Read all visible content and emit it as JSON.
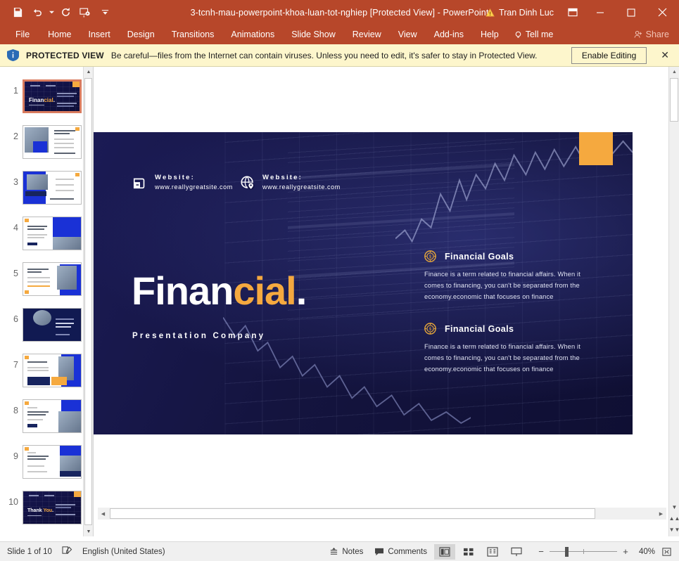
{
  "titlebar": {
    "document_title": "3-tcnh-mau-powerpoint-khoa-luan-tot-nghiep [Protected View]  -  PowerPoint",
    "account_name": "Tran Dinh Luc",
    "qat": [
      {
        "name": "save-icon",
        "label": "Save"
      },
      {
        "name": "undo-icon",
        "label": "Undo"
      },
      {
        "name": "redo-icon",
        "label": "Redo"
      },
      {
        "name": "start-presentation-icon",
        "label": "Start From Beginning"
      },
      {
        "name": "customize-quick-access-toolbar-icon",
        "label": "Customize Quick Access Toolbar"
      }
    ],
    "window_controls": {
      "ribbon_display_options": "Ribbon Display Options",
      "minimize": "Minimize",
      "maximize": "Restore Down",
      "close": "Close"
    }
  },
  "ribbon": {
    "tabs": [
      "File",
      "Home",
      "Insert",
      "Design",
      "Transitions",
      "Animations",
      "Slide Show",
      "Review",
      "View",
      "Add-ins",
      "Help"
    ],
    "tell_me": "Tell me",
    "share": "Share"
  },
  "protected_view": {
    "label": "PROTECTED VIEW",
    "message": "Be careful—files from the Internet can contain viruses. Unless you need to edit, it's safer to stay in Protected View.",
    "enable_button": "Enable Editing",
    "close": "✕"
  },
  "thumbnails": [
    {
      "number": "1",
      "style": "dark-title",
      "selected": true
    },
    {
      "number": "2",
      "style": "white-photo-left",
      "selected": false
    },
    {
      "number": "3",
      "style": "white-blue-left",
      "selected": false
    },
    {
      "number": "4",
      "style": "white-blue-right",
      "selected": false
    },
    {
      "number": "5",
      "style": "white-photo-right",
      "selected": false
    },
    {
      "number": "6",
      "style": "navy-photo",
      "selected": false
    },
    {
      "number": "7",
      "style": "white-photo-blue",
      "selected": false
    },
    {
      "number": "8",
      "style": "white-photo-corner",
      "selected": false
    },
    {
      "number": "9",
      "style": "white-photo-navy",
      "selected": false
    },
    {
      "number": "10",
      "style": "dark-thanks",
      "selected": false
    }
  ],
  "slide": {
    "title_part1": "Finan",
    "title_part2": "cial",
    "title_part3": ".",
    "subtitle": "Presentation Company",
    "contacts": [
      {
        "icon": "wallet-icon",
        "label": "Website:",
        "url": "www.reallygreatsite.com"
      },
      {
        "icon": "globe-pin-icon",
        "label": "Website:",
        "url": "www.reallygreatsite.com"
      }
    ],
    "goals": [
      {
        "icon": "coin-icon",
        "title": "Financial Goals",
        "body": "Finance is a term related to financial affairs. When it comes to financing, you can't be separated from the economy.economic that focuses on finance"
      },
      {
        "icon": "coin-icon",
        "title": "Financial Goals",
        "body": "Finance is a term related to financial affairs. When it comes to financing, you can't be separated from the economy.economic that focuses on finance"
      }
    ],
    "colors": {
      "background": "#141445",
      "accent_orange": "#f5a93f",
      "title_white": "#ffffff"
    }
  },
  "statusbar": {
    "slide_counter": "Slide 1 of 10",
    "spellcheck_icon": "proofing-icon",
    "language": "English (United States)",
    "notes": "Notes",
    "comments": "Comments",
    "views": [
      {
        "name": "normal-view-button",
        "active": true
      },
      {
        "name": "slide-sorter-view-button",
        "active": false
      },
      {
        "name": "reading-view-button",
        "active": false
      },
      {
        "name": "slide-show-button",
        "active": false
      }
    ],
    "zoom_out": "−",
    "zoom_in": "+",
    "zoom_level": "40%",
    "fit_slide": "Fit slide to current window"
  }
}
